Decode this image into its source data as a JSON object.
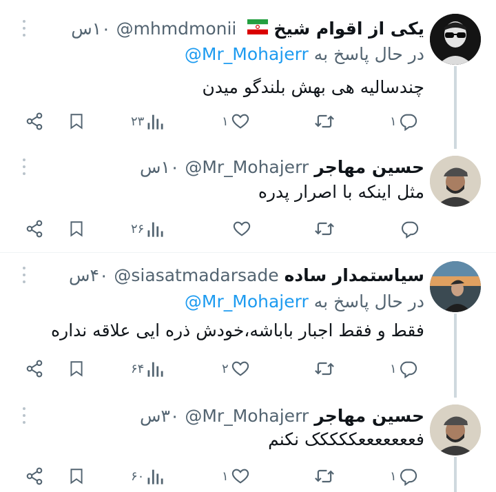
{
  "tweets": [
    {
      "name": "یکی از اقوام شیخ",
      "flag": "iran-flag",
      "handle": "@mhmdmonii",
      "time": "۱۰س",
      "reply_prefix": "در حال پاسخ به",
      "reply_mention": "@Mr_Mohajerr",
      "text": "چندسالیه هی بهش بلندگو میدن",
      "replies": "۱",
      "likes": "۱",
      "views": "۲۳"
    },
    {
      "name": "حسین مهاجر",
      "handle": "@Mr_Mohajerr",
      "time": "۱۰س",
      "text": "مثل اینکه با اصرار پدره",
      "replies": "",
      "likes": "",
      "views": "۲۶"
    },
    {
      "name": "سیاستمدار ساده",
      "handle": "@siasatmadarsade",
      "time": "۴۰س",
      "reply_prefix": "در حال پاسخ به",
      "reply_mention": "@Mr_Mohajerr",
      "text": "فقط و فقط اجبار باباشه،خودش ذره ایی علاقه نداره",
      "replies": "۱",
      "likes": "۲",
      "views": "۶۴"
    },
    {
      "name": "حسین مهاجر",
      "handle": "@Mr_Mohajerr",
      "time": "۳۰س",
      "text": "فعععععععککککک نکنم",
      "replies": "۱",
      "likes": "۱",
      "views": "۶۰"
    }
  ],
  "colors": {
    "text": "#0f1419",
    "muted": "#536471",
    "link": "#1d9bf0",
    "line": "#cfd9de"
  }
}
